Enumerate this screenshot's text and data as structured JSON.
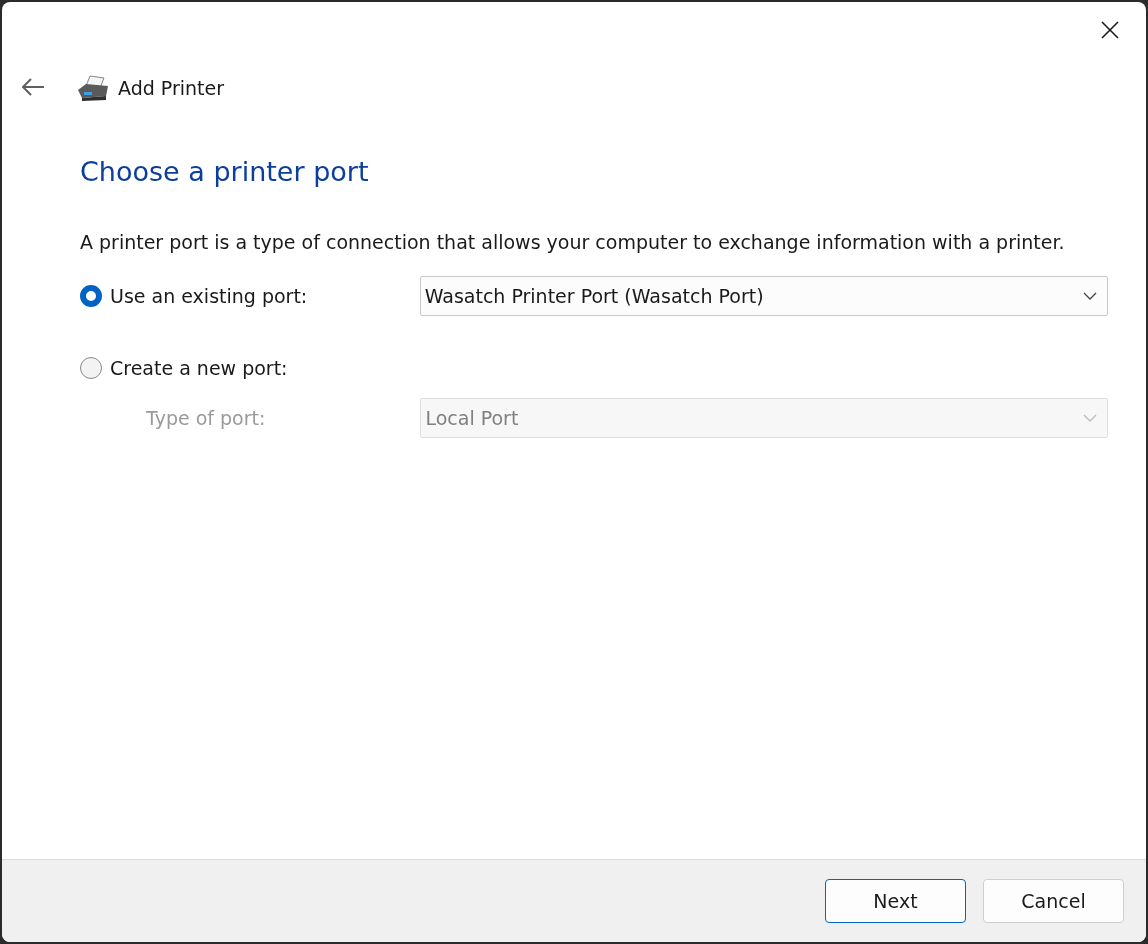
{
  "window": {
    "title": "Add Printer"
  },
  "heading": "Choose a printer port",
  "description": "A printer port is a type of connection that allows your computer to exchange information with a printer.",
  "options": [
    {
      "label": "Use an existing port:",
      "selected": true,
      "dropdown": {
        "value": "Wasatch Printer Port (Wasatch Port)",
        "disabled": false
      }
    },
    {
      "label": "Create a new port:",
      "selected": false
    }
  ],
  "type_of_port": {
    "label": "Type of port:",
    "value": "Local Port",
    "disabled": true
  },
  "buttons": [
    {
      "label": "Next",
      "default": true
    },
    {
      "label": "Cancel",
      "default": false
    }
  ]
}
